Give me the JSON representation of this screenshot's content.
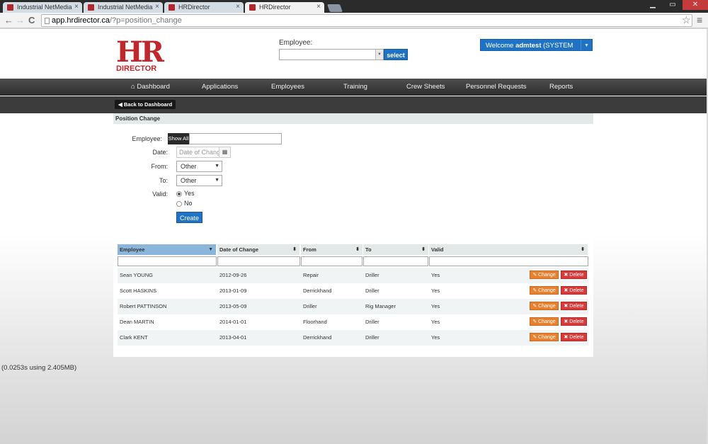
{
  "browser": {
    "tabs": [
      {
        "title": "Industrial NetMedia",
        "close": "×"
      },
      {
        "title": "Industrial NetMedia",
        "close": "×"
      },
      {
        "title": "HRDirector",
        "close": "×"
      },
      {
        "title": "HRDirector",
        "close": "×"
      }
    ],
    "window_controls": {
      "minimize": "▁",
      "restore": "▭",
      "close": "✕"
    },
    "nav": {
      "back": "←",
      "forward": "→",
      "reload": "C"
    },
    "url_domain": "app.hrdirector.ca",
    "url_path": "/?p=position_change",
    "star_icon": "☆",
    "menu_icon": "≡"
  },
  "header": {
    "logo_hr": "HR",
    "logo_director": "DIRECTOR",
    "employee_label": "Employee:",
    "employee_dropdown_arrow": "▼",
    "select_button": "select",
    "welcome_prefix": "Welcome ",
    "welcome_user": "admtest",
    "welcome_role": " (SYSTEM ADMIN)",
    "welcome_caret": "▼"
  },
  "nav": {
    "dashboard_icon": "⌂",
    "items": [
      "Dashboard",
      "Applications",
      "Employees",
      "Training",
      "Crew Sheets",
      "Personnel Requests",
      "Reports"
    ]
  },
  "subbar": {
    "back_icon": "◀",
    "back_label": "Back to Dashboard"
  },
  "panel": {
    "title": "Position Change",
    "employee_label": "Employee:",
    "show_all": "Show All",
    "date_label": "Date:",
    "date_placeholder": "Date of Change",
    "calendar_icon": "▦",
    "from_label": "From:",
    "from_value": "Other",
    "to_label": "To:",
    "to_value": "Other",
    "select_arrow": "▼",
    "valid_label": "Valid:",
    "valid_yes": "Yes",
    "valid_no": "No",
    "create_button": "Create"
  },
  "table": {
    "columns": [
      "Employee",
      "Date of Change",
      "From",
      "To",
      "Valid"
    ],
    "sort_icon": "⬍",
    "sorted_icon": "▼",
    "change_label": "✎ Change",
    "delete_label": "✖ Delete",
    "rows": [
      {
        "employee": "Sean YOUNG",
        "date": "2012-09-26",
        "from": "Repair",
        "to": "Driller",
        "valid": "Yes"
      },
      {
        "employee": "Scott HASKINS",
        "date": "2013-01-09",
        "from": "Derrickhand",
        "to": "Driller",
        "valid": "Yes"
      },
      {
        "employee": "Robert PATTINSON",
        "date": "2013-05-09",
        "from": "Driller",
        "to": "Rig Manager",
        "valid": "Yes"
      },
      {
        "employee": "Dean MARTIN",
        "date": "2014-01-01",
        "from": "Floorhand",
        "to": "Driller",
        "valid": "Yes"
      },
      {
        "employee": "Clark KENT",
        "date": "2013-04-01",
        "from": "Derrickhand",
        "to": "Driller",
        "valid": "Yes"
      }
    ]
  },
  "footer": {
    "debug": "(0.0253s using 2.405MB)"
  }
}
